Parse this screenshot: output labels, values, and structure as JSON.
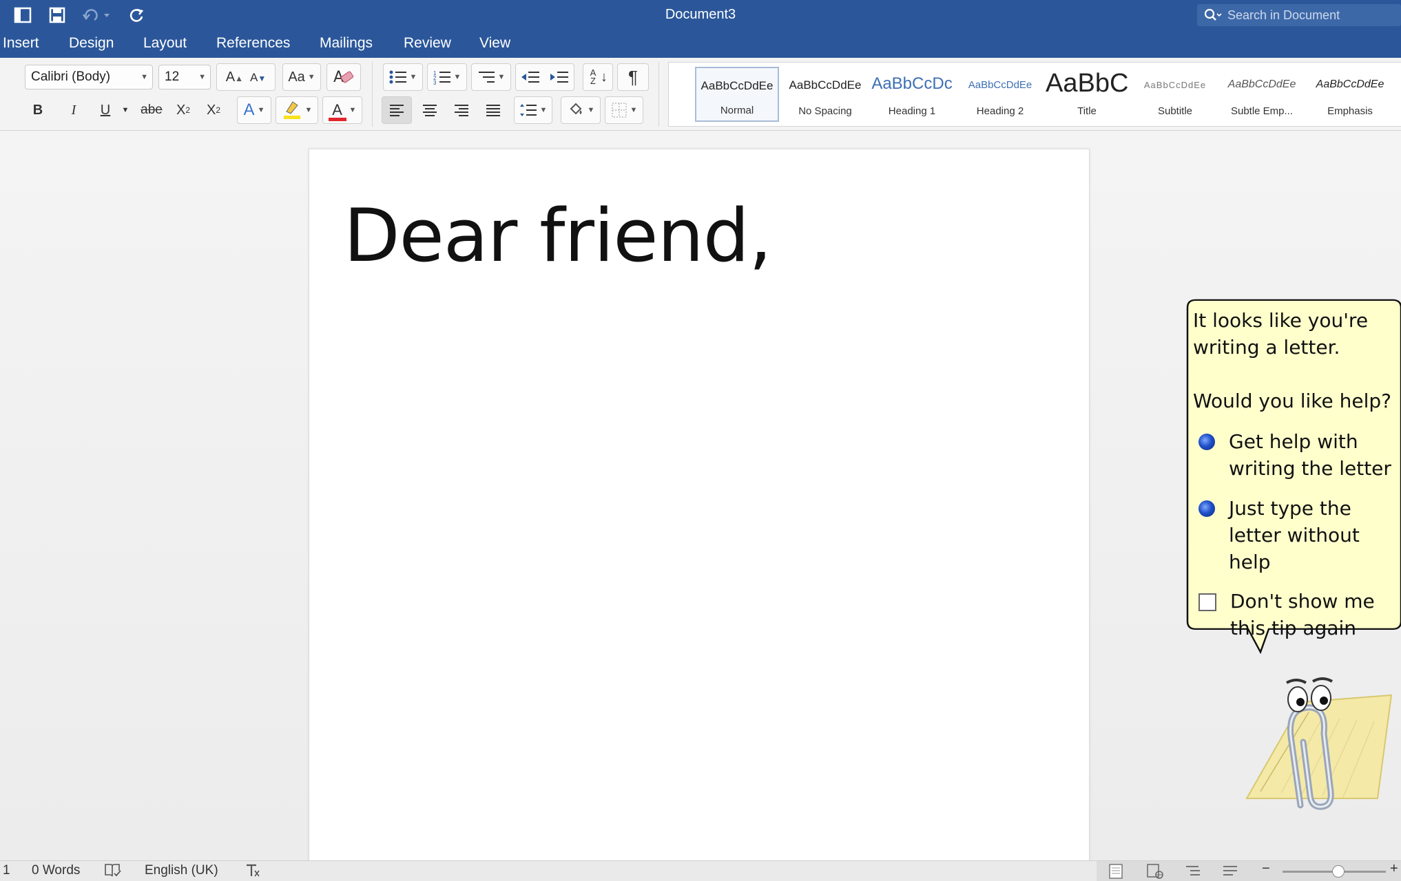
{
  "window": {
    "title": "Document3"
  },
  "search": {
    "placeholder": "Search in Document"
  },
  "tabs": [
    "Insert",
    "Design",
    "Layout",
    "References",
    "Mailings",
    "Review",
    "View"
  ],
  "font": {
    "family": "Calibri (Body)",
    "size": "12"
  },
  "formatting": {
    "bold": "B",
    "italic": "I",
    "underline": "U",
    "strikethrough": "abe",
    "subscript": "X",
    "subscript_mark": "2",
    "superscript": "X",
    "superscript_mark": "2",
    "grow": "A",
    "shrink": "A",
    "change_case": "Aa",
    "text_effects": "A",
    "font_color": "A",
    "sort": "A Z",
    "pilcrow": "¶"
  },
  "styles": [
    {
      "preview": "AaBbCcDdEe",
      "name": "Normal",
      "selected": true
    },
    {
      "preview": "AaBbCcDdEe",
      "name": "No Spacing",
      "selected": false
    },
    {
      "preview": "AaBbCcDc",
      "name": "Heading 1",
      "selected": false
    },
    {
      "preview": "AaBbCcDdEe",
      "name": "Heading 2",
      "selected": false
    },
    {
      "preview": "AaBbC",
      "name": "Title",
      "selected": false
    },
    {
      "preview": "AaBbCcDdEe",
      "name": "Subtitle",
      "selected": false
    },
    {
      "preview": "AaBbCcDdEe",
      "name": "Subtle Emp...",
      "selected": false
    },
    {
      "preview": "AaBbCcDdEe",
      "name": "Emphasis",
      "selected": false
    }
  ],
  "document": {
    "text": "Dear friend,"
  },
  "assistant": {
    "line1": "It looks like you're",
    "line2": "writing a letter.",
    "question": "Would you like help?",
    "option1_a": "Get help with",
    "option1_b": "writing the letter",
    "option2_a": "Just type the",
    "option2_b": "letter without",
    "option2_c": "help",
    "dont_show_a": "Don't show me",
    "dont_show_b": "this tip again"
  },
  "status": {
    "page": "1",
    "words": "0 Words",
    "language": "English (UK)"
  },
  "colors": {
    "brand": "#2b579a",
    "highlight": "#f7e21b",
    "font_color": "#e0262b",
    "balloon": "#ffffcc"
  }
}
